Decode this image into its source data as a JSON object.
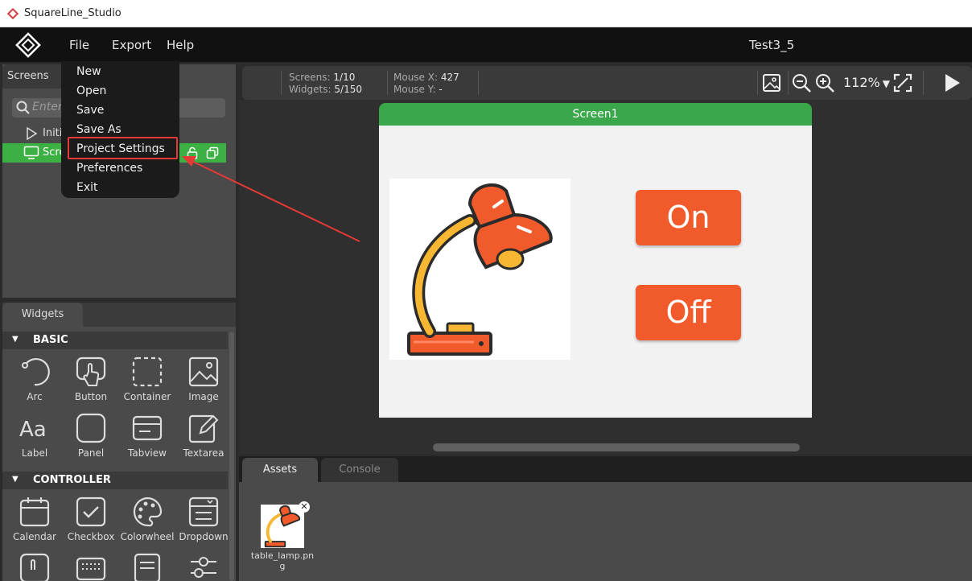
{
  "window": {
    "title": "SquareLine_Studio"
  },
  "menubar": {
    "file": "File",
    "export": "Export",
    "help": "Help",
    "project_title": "Test3_5"
  },
  "file_menu": {
    "items": [
      "New",
      "Open",
      "Save",
      "Save As",
      "Project Settings",
      "Preferences",
      "Exit"
    ]
  },
  "screens_panel": {
    "tab": "Screens",
    "search_placeholder": "Enter",
    "rows": [
      {
        "label": "Initi"
      },
      {
        "label": "Scre"
      }
    ]
  },
  "toolbar": {
    "screens_label": "Screens:",
    "screens_value": "1/10",
    "widgets_label": "Widgets:",
    "widgets_value": "5/150",
    "mouse_x_label": "Mouse X:",
    "mouse_x_value": "427",
    "mouse_y_label": "Mouse Y:",
    "mouse_y_value": "-",
    "zoom": "112%"
  },
  "canvas": {
    "screen_name": "Screen1",
    "button_on": "On",
    "button_off": "Off"
  },
  "widgets_panel": {
    "tab": "Widgets",
    "sections": [
      {
        "name": "BASIC",
        "items": [
          "Arc",
          "Button",
          "Container",
          "Image",
          "Label",
          "Panel",
          "Tabview",
          "Textarea"
        ]
      },
      {
        "name": "CONTROLLER",
        "items": [
          "Calendar",
          "Checkbox",
          "Colorwheel",
          "Dropdown"
        ]
      }
    ]
  },
  "bottom_panel": {
    "assets_tab": "Assets",
    "console_tab": "Console",
    "asset_name": "table_lamp.png"
  },
  "colors": {
    "accent_green": "#3cb043",
    "button_orange": "#f15a2b",
    "annotation_red": "#e53935"
  }
}
